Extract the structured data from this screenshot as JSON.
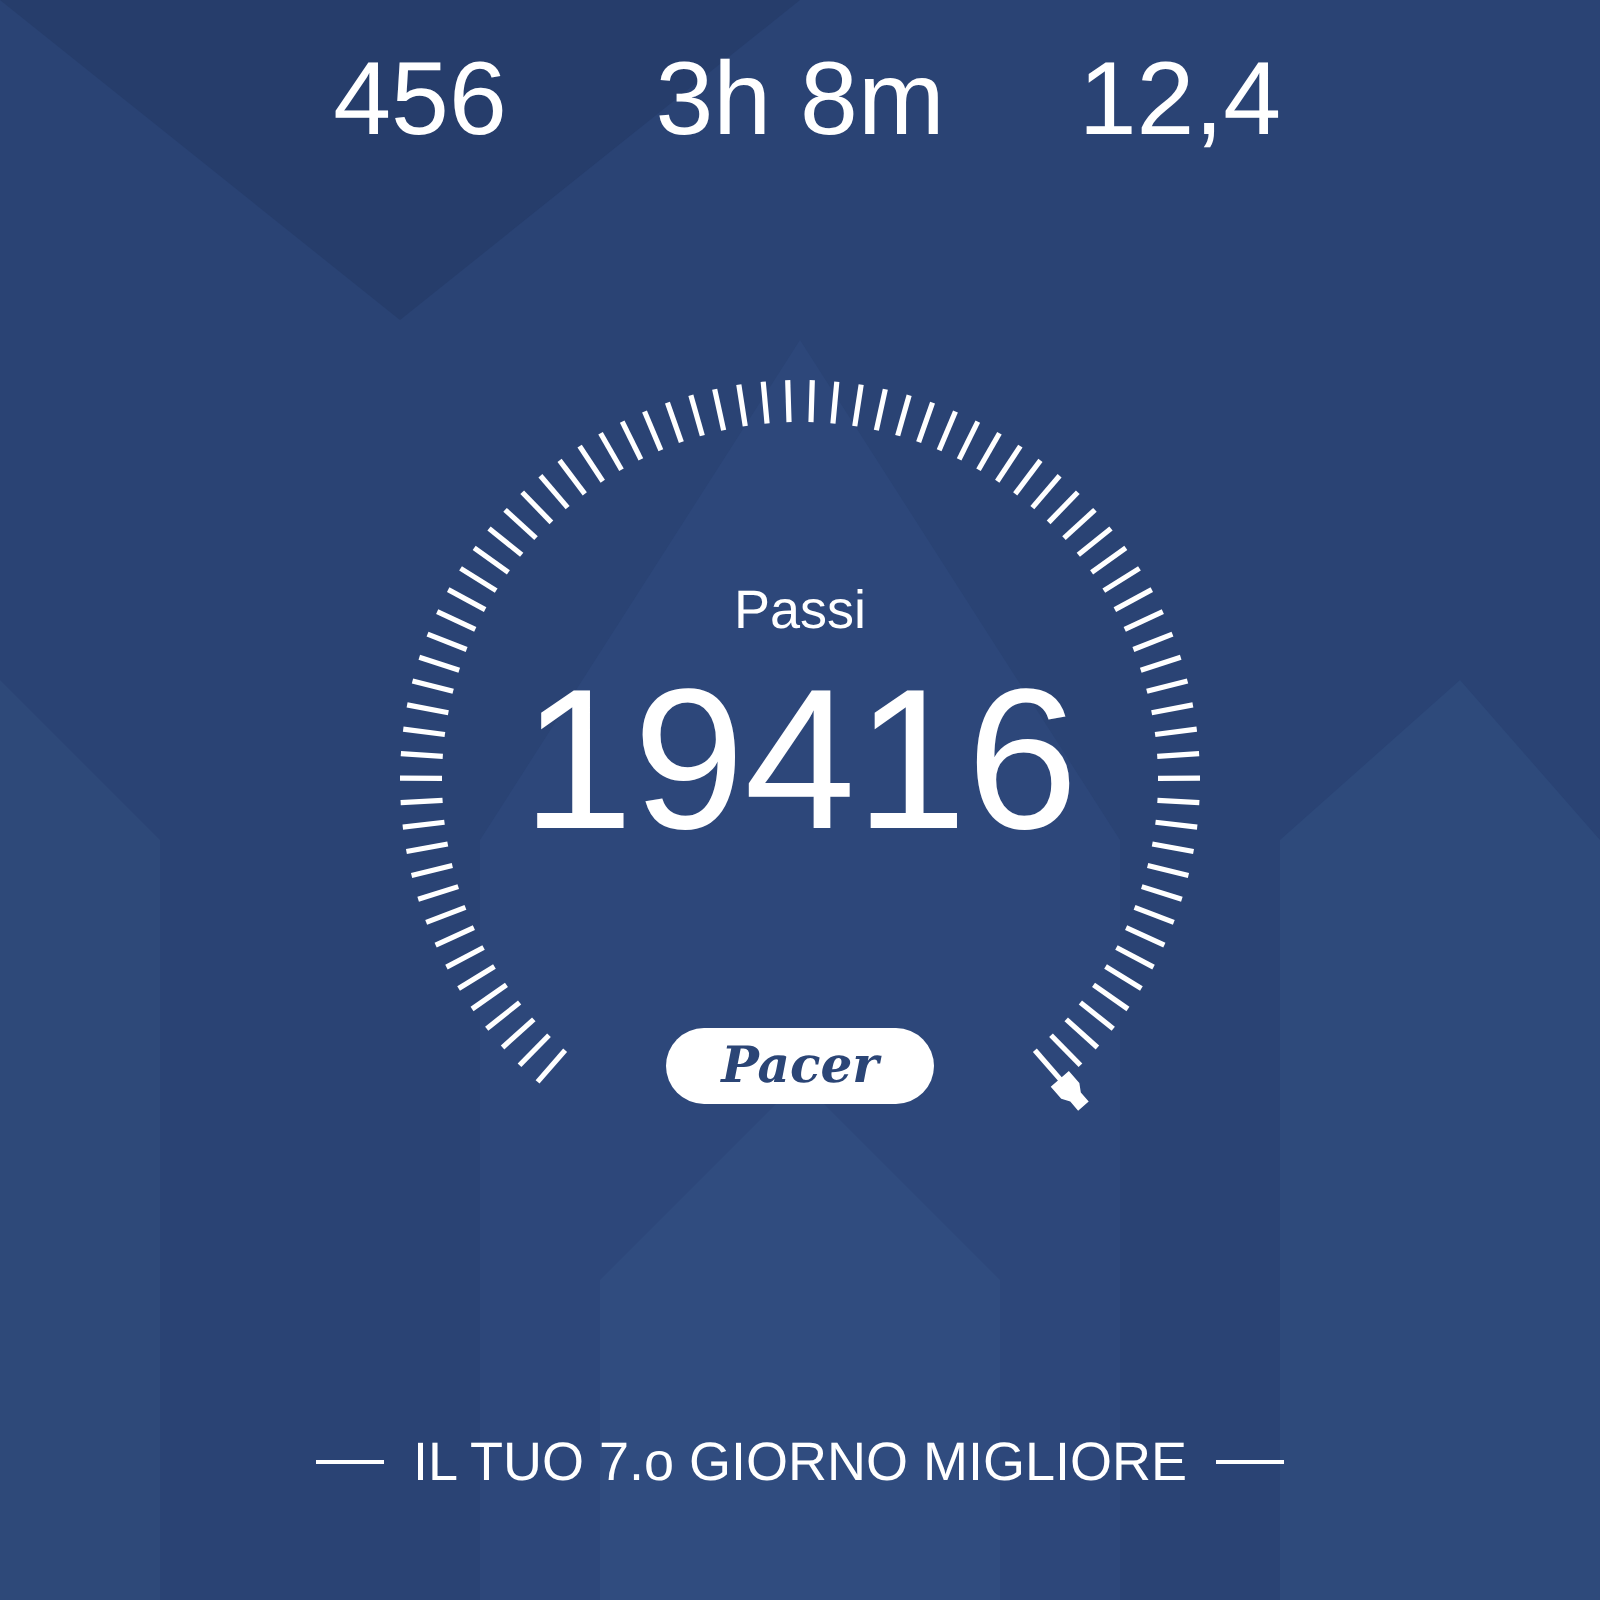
{
  "stats": [
    {
      "value": "456"
    },
    {
      "value": "3h 8m"
    },
    {
      "value": "12,4"
    }
  ],
  "gauge": {
    "label": "Passi",
    "value": "19416"
  },
  "logo": "Pacer",
  "footer": "IL TUO 7.o GIORNO MIGLIORE"
}
